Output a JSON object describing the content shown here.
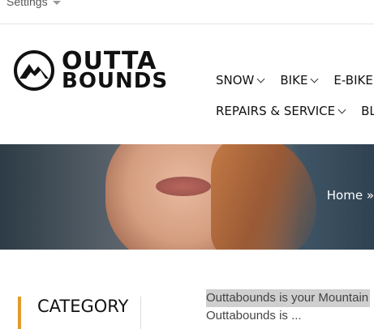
{
  "top_bar": {
    "settings_label": "Settings"
  },
  "logo": {
    "line1": "OUTTA",
    "line2": "BOUNDS"
  },
  "nav": {
    "row1": [
      {
        "label": "SNOW"
      },
      {
        "label": "BIKE"
      },
      {
        "label": "E-BIKE"
      }
    ],
    "row2": [
      {
        "label": "REPAIRS & SERVICE"
      },
      {
        "label": "BLO"
      }
    ]
  },
  "hero": {
    "breadcrumb": "Home »"
  },
  "sidebar": {
    "category_title": "CATEGORY"
  },
  "main": {
    "intro_line1": "Outtabounds is your Mountain",
    "intro_line2": "Outtabounds is ..."
  }
}
